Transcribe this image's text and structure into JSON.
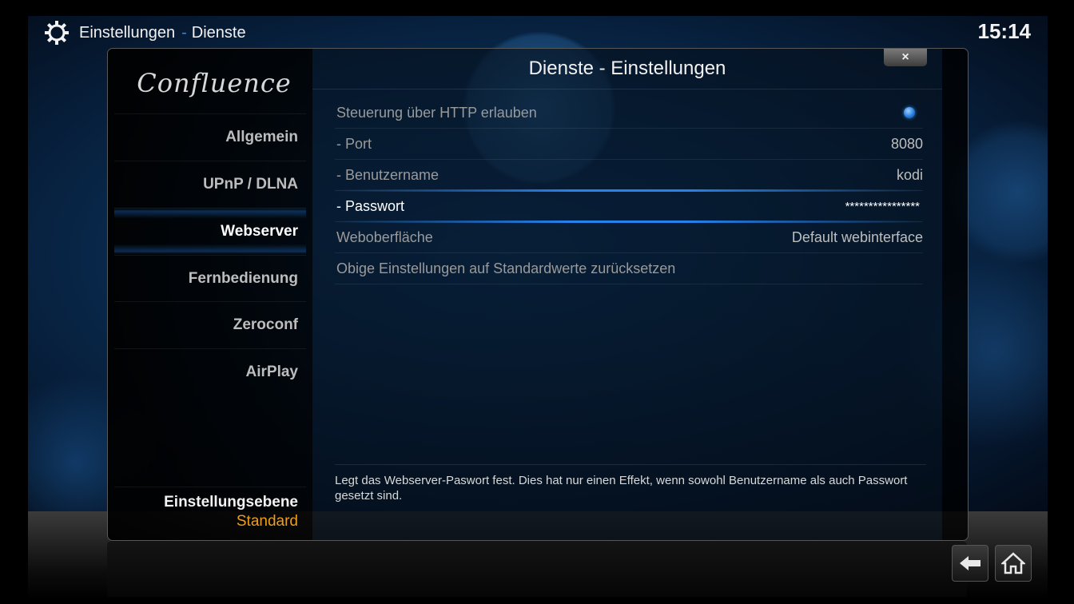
{
  "header": {
    "title": "Einstellungen",
    "separator": "-",
    "subtitle": "Dienste",
    "clock": "15:14"
  },
  "logo": "Confluence",
  "sidebar": {
    "items": [
      {
        "label": "Allgemein"
      },
      {
        "label": "UPnP / DLNA"
      },
      {
        "label": "Webserver",
        "active": true
      },
      {
        "label": "Fernbedienung"
      },
      {
        "label": "Zeroconf"
      },
      {
        "label": "AirPlay"
      }
    ],
    "level_label": "Einstellungsebene",
    "level_value": "Standard"
  },
  "dialog": {
    "title": "Dienste - Einstellungen",
    "close_label": "×"
  },
  "settings": [
    {
      "label": "Steuerung über HTTP erlauben",
      "type": "toggle",
      "value_on": true
    },
    {
      "label": "- Port",
      "value": "8080"
    },
    {
      "label": "- Benutzername",
      "value": "kodi"
    },
    {
      "label": "- Passwort",
      "value": "****************",
      "focused": true
    },
    {
      "label": "Weboberfläche",
      "value": "Default webinterface"
    },
    {
      "label": "Obige Einstellungen auf Standardwerte zurücksetzen",
      "value": ""
    }
  ],
  "help_text": "Legt das Webserver-Paswort fest. Dies hat nur einen Effekt, wenn sowohl Benutzername als auch Passwort gesetzt sind.",
  "nav": {
    "back_icon": "back-arrow-icon",
    "home_icon": "home-icon"
  },
  "colors": {
    "accent": "#2a8ae6",
    "level_value": "#eb9e1c"
  }
}
